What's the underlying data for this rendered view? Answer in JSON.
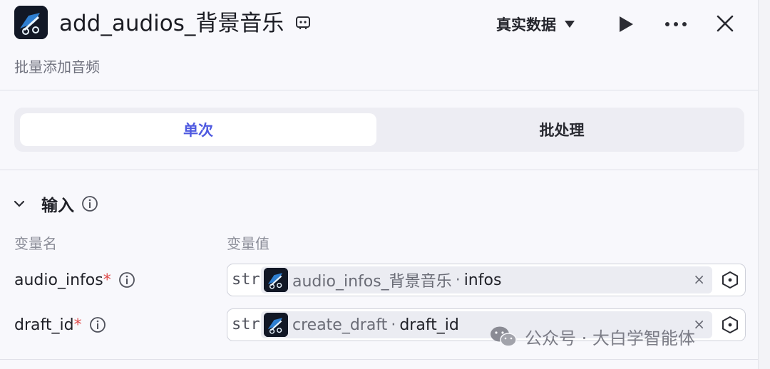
{
  "header": {
    "title": "add_audios_背景音乐",
    "subtitle": "批量添加音频",
    "data_select": "真实数据"
  },
  "tabs": [
    {
      "label": "单次",
      "active": true
    },
    {
      "label": "批处理",
      "active": false
    }
  ],
  "input_section": {
    "title": "输入",
    "col_name": "变量名",
    "col_value": "变量值",
    "params": [
      {
        "name": "audio_infos",
        "required_mark": "*",
        "type": "str.",
        "node": "audio_infos_背景音乐",
        "separator": "·",
        "field": "infos",
        "clear": "×"
      },
      {
        "name": "draft_id",
        "required_mark": "*",
        "type": "str.",
        "node": "create_draft",
        "separator": "·",
        "field": "draft_id",
        "clear": "×"
      }
    ]
  },
  "watermark": "公众号 · 大白学智能体",
  "colors": {
    "accent": "#4f5ae0",
    "required": "#e04b4b",
    "panel_bg": "#f8f8fc"
  },
  "icons": [
    "app-icon",
    "template-icon",
    "play-icon",
    "more-icon",
    "close-icon",
    "chevron-down-icon",
    "info-icon",
    "variable-icon",
    "wechat-icon"
  ]
}
